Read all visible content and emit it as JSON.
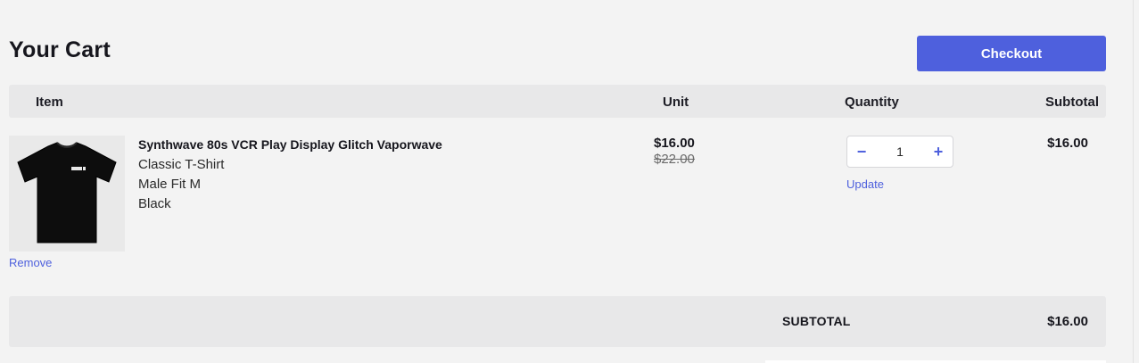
{
  "header": {
    "title": "Your Cart",
    "checkout_label": "Checkout"
  },
  "table": {
    "columns": {
      "item": "Item",
      "unit": "Unit",
      "quantity": "Quantity",
      "subtotal": "Subtotal"
    }
  },
  "cart": {
    "items": [
      {
        "name": "Synthwave 80s VCR Play Display Glitch Vaporwave",
        "product_type": "Classic T-Shirt",
        "fit_size": "Male Fit M",
        "color": "Black",
        "image_icon": "black-tshirt-product-image",
        "unit_price": "$16.00",
        "original_price": "$22.00",
        "quantity": "1",
        "decrement_symbol": "−",
        "increment_symbol": "+",
        "update_label": "Update",
        "remove_label": "Remove",
        "subtotal": "$16.00"
      }
    ]
  },
  "summary": {
    "label": "SUBTOTAL",
    "value": "$16.00"
  },
  "colors": {
    "accent": "#4e60dd",
    "background": "#f3f3f3",
    "header_bar": "#e8e8e9",
    "text": "#16161d"
  }
}
